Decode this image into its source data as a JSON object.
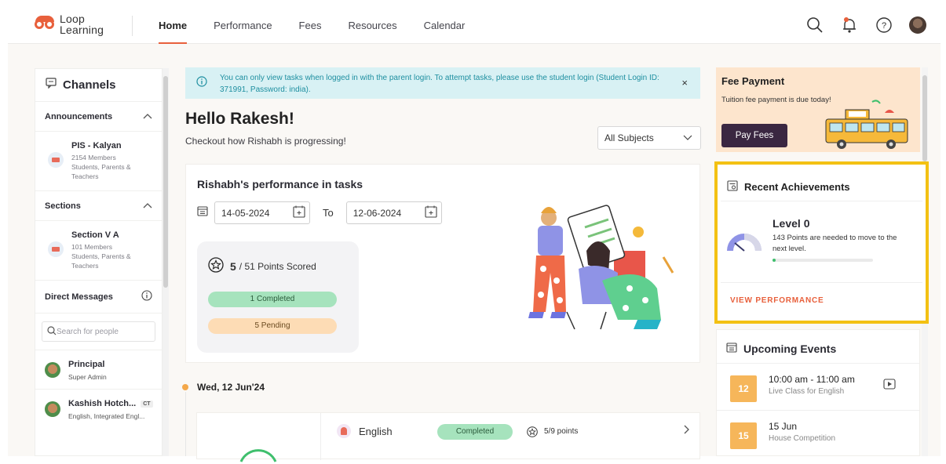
{
  "app": {
    "logo_line1": "Loop",
    "logo_line2": "Learning",
    "brand_color": "#e8603c"
  },
  "nav": {
    "items": [
      {
        "label": "Home",
        "active": true
      },
      {
        "label": "Performance"
      },
      {
        "label": "Fees"
      },
      {
        "label": "Resources"
      },
      {
        "label": "Calendar"
      }
    ],
    "icons": [
      "search-icon",
      "notification-bell-icon",
      "help-icon",
      "avatar"
    ]
  },
  "channels": {
    "title": "Channels",
    "announcements": {
      "label": "Announcements",
      "items": [
        {
          "name": "PIS - Kalyan",
          "desc": "2154 Members Students, Parents & Teachers"
        }
      ]
    },
    "sections": {
      "label": "Sections",
      "items": [
        {
          "name": "Section V A",
          "desc": "101 Members Students, Parents & Teachers"
        }
      ]
    },
    "direct_messages": {
      "label": "Direct Messages",
      "search_placeholder": "Search for people",
      "items": [
        {
          "name": "Principal",
          "role": "Super Admin"
        },
        {
          "name": "Kashish Hotch...",
          "tag": "CT",
          "role": "English, Integrated Engl..."
        }
      ]
    }
  },
  "banner": {
    "message": "You can only view tasks when logged in with the parent login. To attempt tasks, please use the student login (Student Login ID: 371991, Password: india).",
    "close": "×"
  },
  "greeting": {
    "title": "Hello Rakesh!",
    "subtitle": "Checkout how Rishabh is progressing!"
  },
  "subject_filter": {
    "selected": "All Subjects"
  },
  "performance": {
    "title": "Rishabh's performance in tasks",
    "from_date": "14-05-2024",
    "to_label": "To",
    "to_date": "12-06-2024",
    "points_scored": "5",
    "points_total": "/ 51 Points Scored",
    "completed": "1 Completed",
    "pending": "5 Pending"
  },
  "timeline": {
    "date": "Wed, 12 Jun'24",
    "task": {
      "subject": "English",
      "status": "Completed",
      "points": "5/9 points"
    }
  },
  "fee_payment": {
    "title": "Fee Payment",
    "desc": "Tuition fee payment is due today!",
    "button": "Pay Fees"
  },
  "achievements": {
    "title": "Recent Achievements",
    "level": "Level 0",
    "desc": "143 Points are needed to move to the next level.",
    "progress": 0.03,
    "link": "VIEW PERFORMANCE",
    "highlight_color": "#f3c113"
  },
  "events": {
    "title": "Upcoming Events",
    "items": [
      {
        "day": "12",
        "time": "10:00 am - 11:00 am",
        "desc": "Live Class for English"
      },
      {
        "day": "15",
        "time": "15 Jun",
        "desc": "House Competition"
      }
    ]
  }
}
